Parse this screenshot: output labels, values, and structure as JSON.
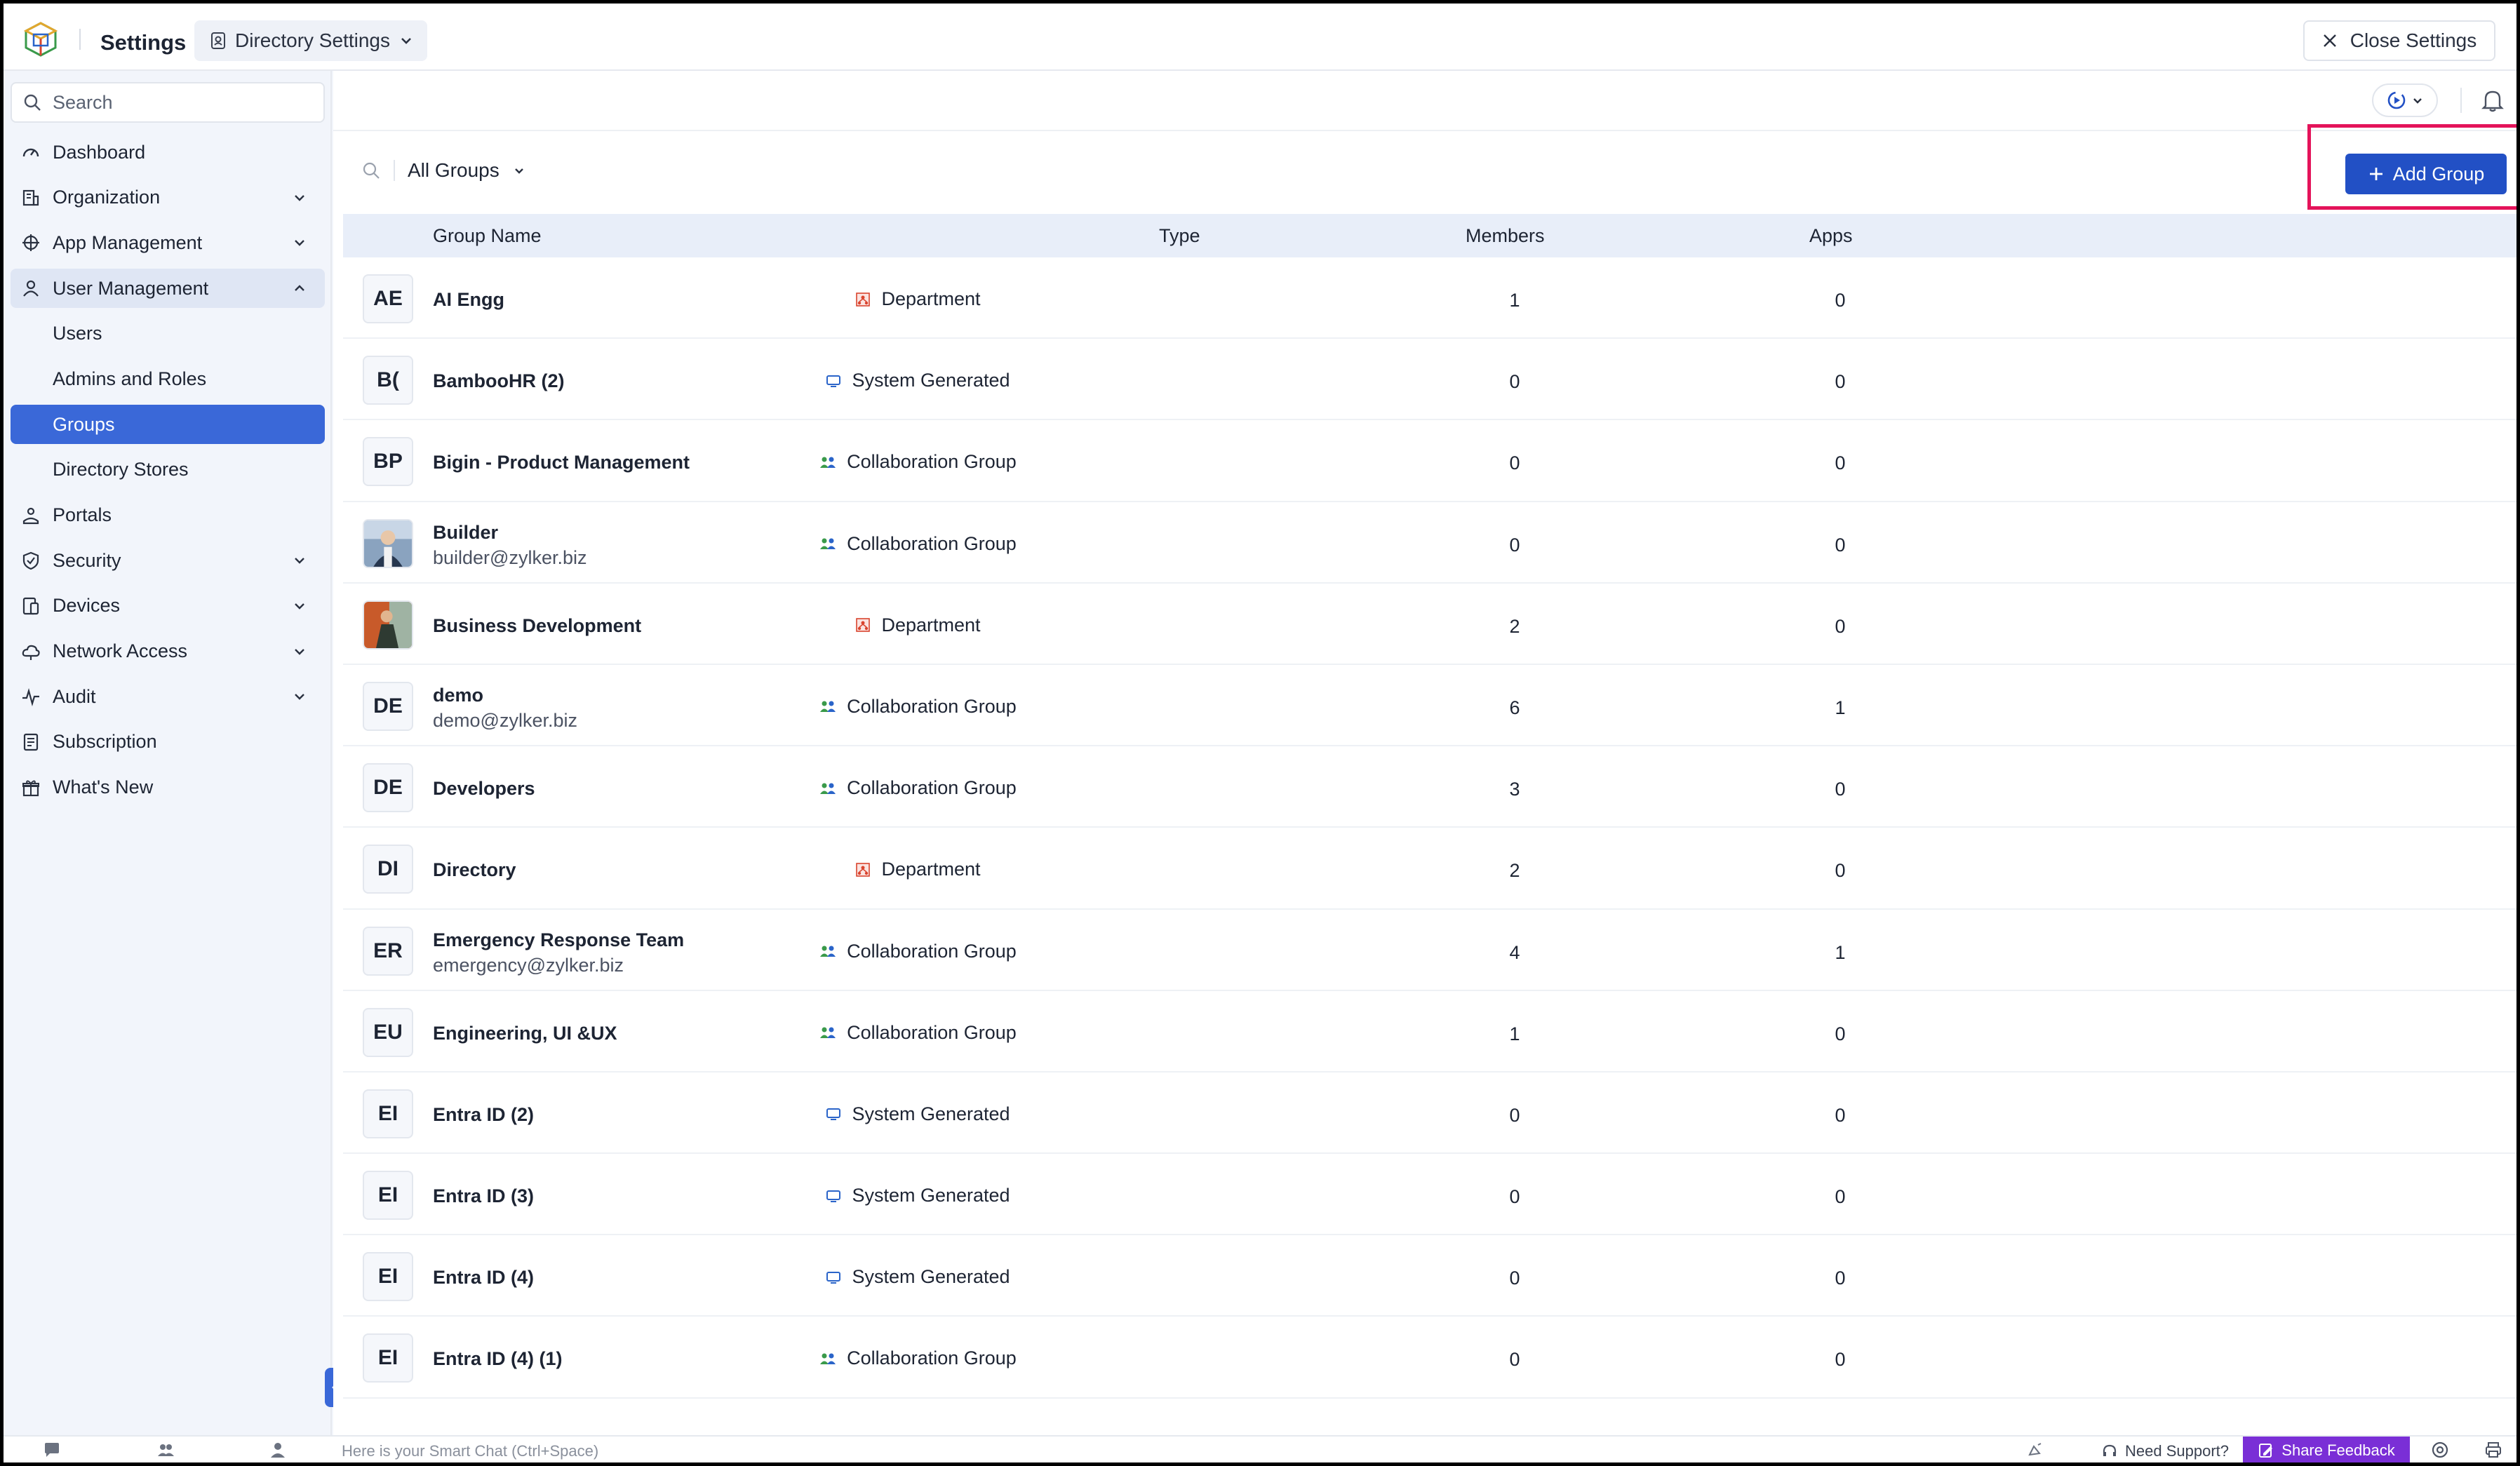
{
  "header": {
    "title": "Settings",
    "section_dropdown": "Directory Settings",
    "close_label": "Close Settings"
  },
  "sidebar": {
    "search_placeholder": "Search",
    "items": [
      {
        "label": "Dashboard",
        "icon": "dashboard-icon"
      },
      {
        "label": "Organization",
        "icon": "organization-icon"
      },
      {
        "label": "App Management",
        "icon": "app-management-icon"
      },
      {
        "label": "User Management",
        "icon": "user-icon"
      },
      {
        "label": "Users"
      },
      {
        "label": "Admins and Roles"
      },
      {
        "label": "Groups"
      },
      {
        "label": "Directory Stores"
      },
      {
        "label": "Portals",
        "icon": "portals-icon"
      },
      {
        "label": "Security",
        "icon": "shield-icon"
      },
      {
        "label": "Devices",
        "icon": "devices-icon"
      },
      {
        "label": "Network Access",
        "icon": "cloud-icon"
      },
      {
        "label": "Audit",
        "icon": "pulse-icon"
      },
      {
        "label": "Subscription",
        "icon": "subscription-icon"
      },
      {
        "label": "What's New",
        "icon": "gift-icon"
      }
    ]
  },
  "main": {
    "filter_label": "All Groups",
    "add_button_label": "Add Group",
    "columns": [
      "Group Name",
      "Type",
      "Members",
      "Apps"
    ],
    "rows": [
      {
        "initials": "AE",
        "name": "AI Engg",
        "email": "",
        "type": "Department",
        "members": "1",
        "apps": "0"
      },
      {
        "initials": "B(",
        "name": "BambooHR (2)",
        "email": "",
        "type": "System Generated",
        "members": "0",
        "apps": "0"
      },
      {
        "initials": "BP",
        "name": "Bigin - Product Management",
        "email": "",
        "type": "Collaboration Group",
        "members": "0",
        "apps": "0"
      },
      {
        "initials": "",
        "name": "Builder",
        "email": "builder@zylker.biz",
        "type": "Collaboration Group",
        "members": "0",
        "apps": "0"
      },
      {
        "initials": "",
        "name": "Business Development",
        "email": "",
        "type": "Department",
        "members": "2",
        "apps": "0"
      },
      {
        "initials": "DE",
        "name": "demo",
        "email": "demo@zylker.biz",
        "type": "Collaboration Group",
        "members": "6",
        "apps": "1"
      },
      {
        "initials": "DE",
        "name": "Developers",
        "email": "",
        "type": "Collaboration Group",
        "members": "3",
        "apps": "0"
      },
      {
        "initials": "DI",
        "name": "Directory",
        "email": "",
        "type": "Department",
        "members": "2",
        "apps": "0"
      },
      {
        "initials": "ER",
        "name": "Emergency Response Team",
        "email": "emergency@zylker.biz",
        "type": "Collaboration Group",
        "members": "4",
        "apps": "1"
      },
      {
        "initials": "EU",
        "name": "Engineering, UI &UX",
        "email": "",
        "type": "Collaboration Group",
        "members": "1",
        "apps": "0"
      },
      {
        "initials": "EI",
        "name": "Entra ID (2)",
        "email": "",
        "type": "System Generated",
        "members": "0",
        "apps": "0"
      },
      {
        "initials": "EI",
        "name": "Entra ID (3)",
        "email": "",
        "type": "System Generated",
        "members": "0",
        "apps": "0"
      },
      {
        "initials": "EI",
        "name": "Entra ID (4)",
        "email": "",
        "type": "System Generated",
        "members": "0",
        "apps": "0"
      },
      {
        "initials": "EI",
        "name": "Entra ID (4) (1)",
        "email": "",
        "type": "Collaboration Group",
        "members": "0",
        "apps": "0"
      }
    ]
  },
  "footer": {
    "chat_placeholder": "Here is your Smart Chat (Ctrl+Space)",
    "need_support": "Need Support?",
    "share_feedback": "Share Feedback"
  },
  "colors": {
    "accent": "#3a68d8",
    "primary_button": "#2250c5",
    "highlight_box": "#e4135a",
    "feedback": "#7a2fd6"
  }
}
